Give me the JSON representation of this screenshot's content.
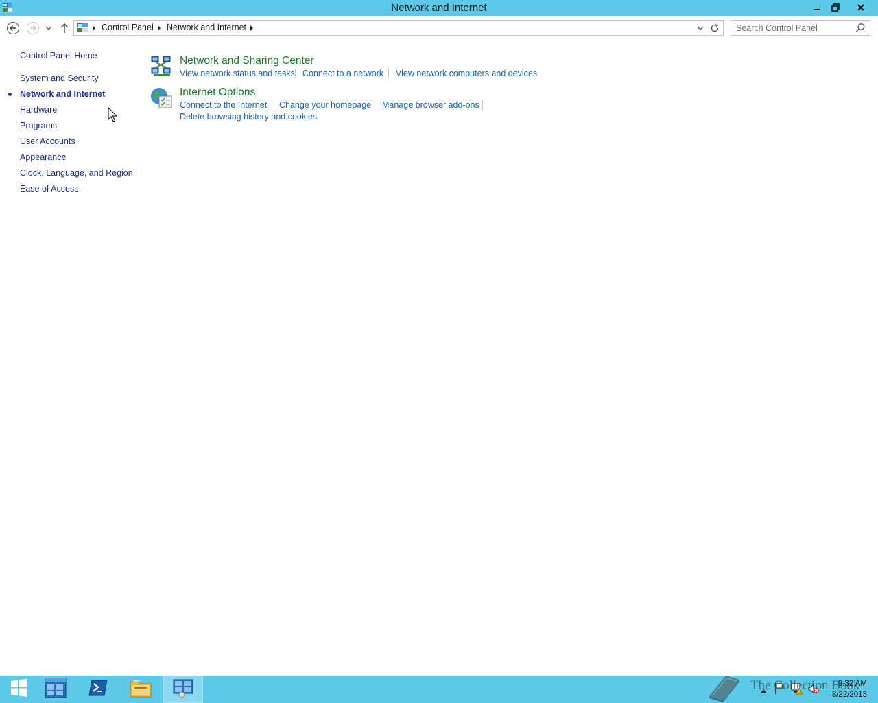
{
  "window": {
    "title": "Network and Internet"
  },
  "address_bar": {
    "breadcrumbs": [
      "Control Panel",
      "Network and Internet"
    ]
  },
  "search": {
    "placeholder": "Search Control Panel"
  },
  "left_nav": {
    "home": "Control Panel Home",
    "items": [
      "System and Security",
      "Network and Internet",
      "Hardware",
      "Programs",
      "User Accounts",
      "Appearance",
      "Clock, Language, and Region",
      "Ease of Access"
    ],
    "current": "Network and Internet"
  },
  "categories": [
    {
      "title": "Network and Sharing Center",
      "icon": "network-sharing-icon",
      "links": [
        "View network status and tasks",
        "Connect to a network",
        "View network computers and devices"
      ]
    },
    {
      "title": "Internet Options",
      "icon": "internet-options-icon",
      "links": [
        "Connect to the Internet",
        "Change your homepage",
        "Manage browser add-ons",
        "Delete browsing history and cookies"
      ]
    }
  ],
  "taskbar": {
    "items": [
      "start-icon",
      "server-manager-icon",
      "powershell-icon",
      "file-explorer-icon",
      "control-panel-icon"
    ],
    "active": "control-panel-icon",
    "clock_time": "9:32 AM",
    "clock_date": "8/22/2013"
  },
  "watermark": {
    "text": "The Collection Book"
  },
  "colors": {
    "titlebar": "#5dc9e8",
    "category_title": "#1e7a2a",
    "link": "#1e66b4",
    "nav_link": "#1e3287"
  }
}
